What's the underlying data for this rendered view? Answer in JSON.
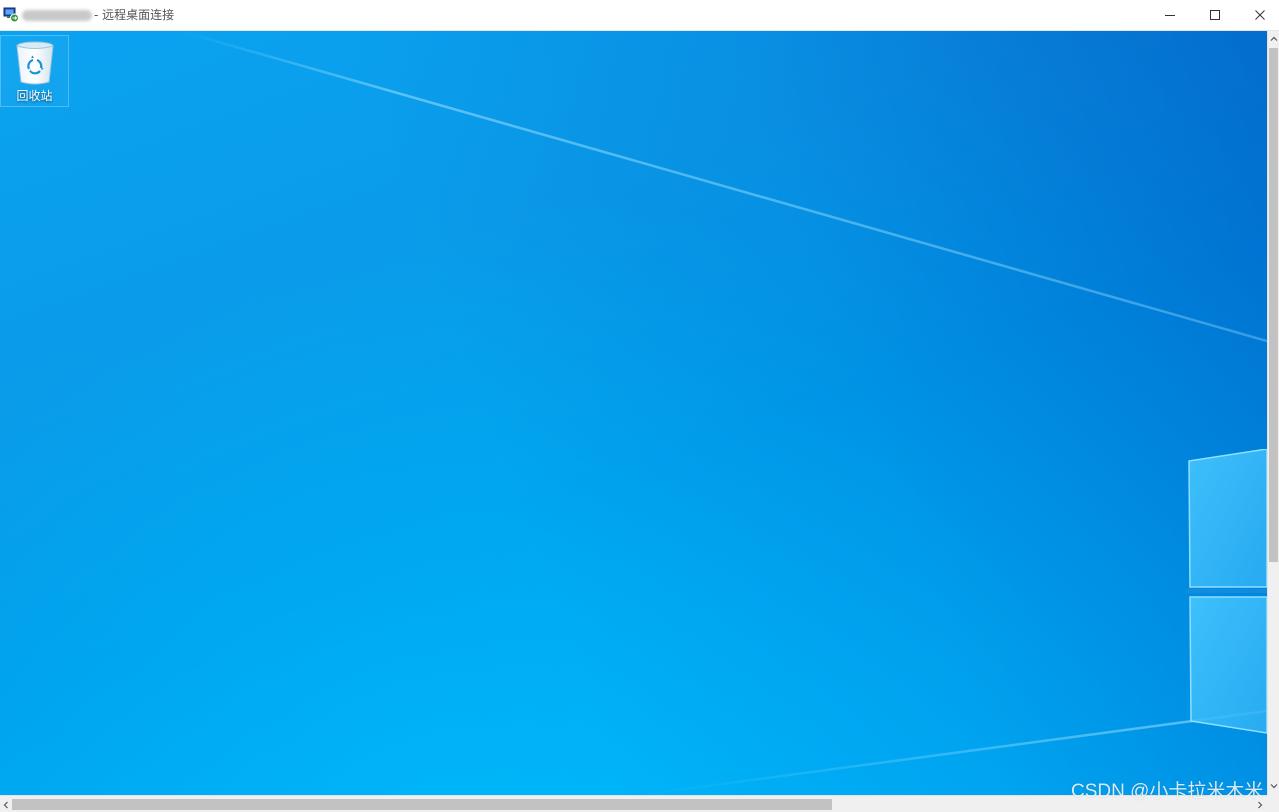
{
  "window": {
    "title_suffix": "- 远程桌面连接",
    "icons": {
      "app": "remote-desktop-icon",
      "minimize": "minimize-icon",
      "maximize": "maximize-icon",
      "close": "close-icon"
    }
  },
  "desktop": {
    "icons": [
      {
        "label": "回收站",
        "icon": "recycle-bin-icon"
      }
    ]
  },
  "watermark": {
    "text": "CSDN @小卡拉米木米"
  },
  "colors": {
    "wallpaper_top": "#0a9be9",
    "wallpaper_bottom": "#00b5fb",
    "logo_pane": "#3dc1ff",
    "scrollbar_track": "#f0f0f0",
    "scrollbar_thumb": "#c2c2c2"
  }
}
